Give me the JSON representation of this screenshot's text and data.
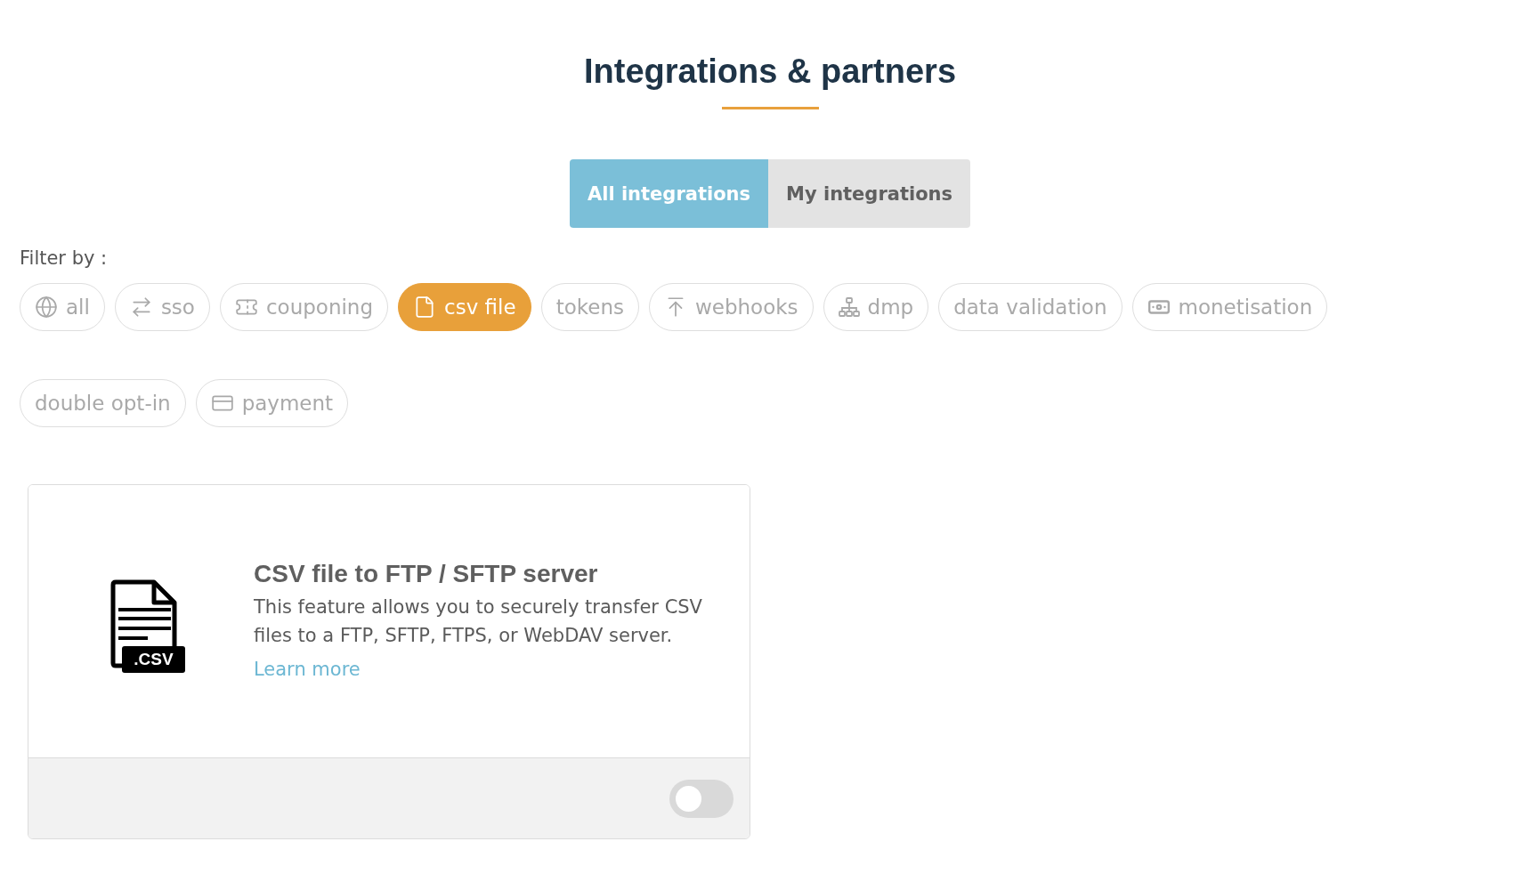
{
  "page": {
    "title": "Integrations & partners"
  },
  "tabs": [
    {
      "label": "All integrations",
      "selected": true
    },
    {
      "label": "My integrations",
      "selected": false
    }
  ],
  "filters": {
    "label": "Filter by :",
    "chips": [
      {
        "label": "all",
        "kind": "globe",
        "selected": false
      },
      {
        "label": "sso",
        "kind": "arrows",
        "selected": false
      },
      {
        "label": "couponing",
        "kind": "ticket",
        "selected": false
      },
      {
        "label": "csv file",
        "kind": "file",
        "selected": true
      },
      {
        "label": "tokens",
        "kind": "text",
        "selected": false
      },
      {
        "label": "webhooks",
        "kind": "upload",
        "selected": false
      },
      {
        "label": "dmp",
        "kind": "network",
        "selected": false
      },
      {
        "label": "data validation",
        "kind": "text",
        "selected": false
      },
      {
        "label": "monetisation",
        "kind": "cash",
        "selected": false
      },
      {
        "label": "double opt-in",
        "kind": "text",
        "selected": false
      },
      {
        "label": "payment",
        "kind": "card",
        "selected": false
      }
    ]
  },
  "integrations": [
    {
      "title": "CSV file to FTP / SFTP server",
      "file_type": ".CSV",
      "description": "This feature allows you to securely transfer CSV files to a FTP, SFTP, FTPS, or WebDAV server.",
      "link": "Learn more",
      "enabled": false
    }
  ]
}
